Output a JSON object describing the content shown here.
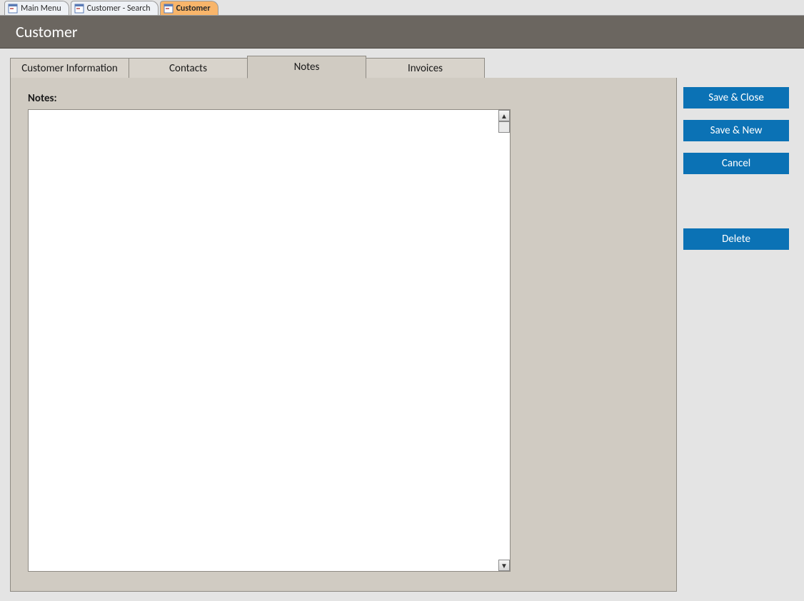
{
  "doc_tabs": [
    {
      "label": "Main Menu",
      "active": false
    },
    {
      "label": "Customer - Search",
      "active": false
    },
    {
      "label": "Customer",
      "active": true
    }
  ],
  "title": "Customer",
  "page_tabs": [
    {
      "label": "Customer Information",
      "active": false
    },
    {
      "label": "Contacts",
      "active": false
    },
    {
      "label": "Notes",
      "active": true
    },
    {
      "label": "Invoices",
      "active": false
    }
  ],
  "notes": {
    "label": "Notes:",
    "value": ""
  },
  "buttons": {
    "save_close": "Save & Close",
    "save_new": "Save & New",
    "cancel": "Cancel",
    "delete": "Delete"
  }
}
